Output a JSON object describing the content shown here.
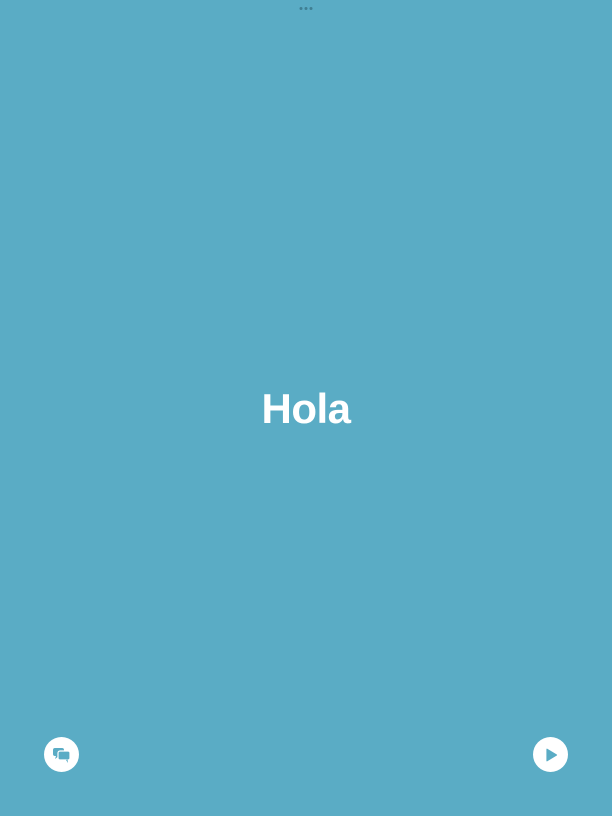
{
  "window": {
    "multitask_handle_icon": "ellipsis-icon"
  },
  "card": {
    "word": "Hola",
    "background_color": "#5aacc5",
    "text_color": "#ffffff"
  },
  "controls": {
    "left_button_icon": "speech-bubbles-icon",
    "right_button_icon": "play-icon"
  }
}
